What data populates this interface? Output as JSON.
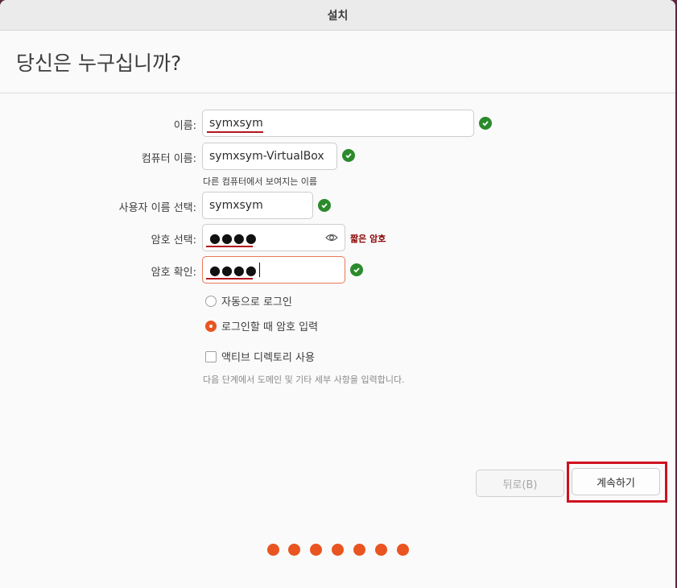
{
  "window": {
    "title": "설치"
  },
  "page": {
    "heading": "당신은 누구십니까?"
  },
  "form": {
    "name": {
      "label": "이름:",
      "value": "symxsym"
    },
    "computer_name": {
      "label": "컴퓨터 이름:",
      "value": "symxsym-VirtualBox",
      "hint": "다른 컴퓨터에서 보여지는 이름"
    },
    "username": {
      "label": "사용자 이름 선택:",
      "value": "symxsym"
    },
    "password": {
      "label": "암호 선택:",
      "value": "●●●●",
      "warning": "짧은 암호"
    },
    "confirm_password": {
      "label": "암호 확인:",
      "value": "●●●●"
    },
    "login_options": [
      {
        "label": "자동으로 로그인",
        "selected": false
      },
      {
        "label": "로그인할 때 암호 입력",
        "selected": true
      }
    ],
    "active_directory": {
      "label": "액티브 디렉토리 사용",
      "checked": false,
      "hint": "다음 단계에서 도메인 및 기타 세부 사항을 입력합니다."
    }
  },
  "buttons": {
    "back": "뒤로(B)",
    "next": "계속하기"
  },
  "progress": {
    "total_steps": 7
  },
  "colors": {
    "accent": "#e95420",
    "success": "#2b8a2b",
    "warning": "#8b0000",
    "highlight": "#d0101e"
  }
}
